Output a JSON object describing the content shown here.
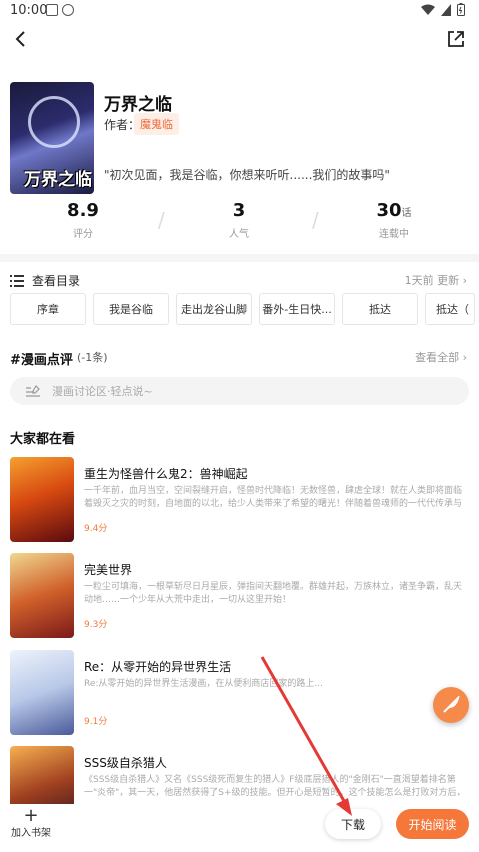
{
  "status": {
    "time": "10:00"
  },
  "book": {
    "title": "万界之临",
    "author_label": "作者：",
    "author": "魔鬼临",
    "cover_text": "万界之临",
    "quote": "\"初次见面，我是谷临，你想来听听......我们的故事吗\""
  },
  "stats": [
    {
      "value": "8.9",
      "unit": "",
      "label": "评分"
    },
    {
      "value": "3",
      "unit": "",
      "label": "人气"
    },
    {
      "value": "30",
      "unit": "话",
      "label": "连载中"
    }
  ],
  "catalog": {
    "title": "查看目录",
    "update": "1天前 更新 ›",
    "chapters": [
      "序章",
      "我是谷临",
      "走出龙谷山脚",
      "番外-生日快...",
      "抵达",
      "抵达（"
    ]
  },
  "comments": {
    "title": "#漫画点评",
    "count": "(-1条)",
    "view_all": "查看全部 ›",
    "placeholder": "漫画讨论区·轻点说~"
  },
  "recommend": {
    "title": "大家都在看",
    "items": [
      {
        "name": "重生为怪兽什么鬼2：兽神崛起",
        "desc": "一千年前，血月当空，空间裂缝开启，怪兽时代降临！无数怪兽，肆虐全球！就在人类即将面临着毁灭之灾的时刻，自地面的以北，给少人类带来了希望的曙光！伴随着兽魂师的一代代传承与发展，人类成功创造出...",
        "score": "9.4分",
        "colors": [
          "#f07a1a",
          "#8a1a0a"
        ]
      },
      {
        "name": "完美世界",
        "desc": "一粒尘可填海，一根草斩尽日月星辰，弹指间天翻地覆。群雄并起，万族林立，诸圣争霸，乱天动地……一个少年从大荒中走出，一切从这里开始！",
        "score": "9.3分",
        "colors": [
          "#e8c070",
          "#a0301a"
        ]
      },
      {
        "name": "Re：从零开始的异世界生活",
        "desc": "Re:从零开始的异世界生活漫画，在从便利商店回家的路上...",
        "score": "9.1分",
        "colors": [
          "#d8e4f4",
          "#7a8ac0"
        ]
      },
      {
        "name": "SSS级自杀猎人",
        "desc": "《SSS级自杀猎人》又名《SSS级死而复生的猎人》F级底层猎人的\"金刚石\"一直渴望着排名第一\"炎帝\"，其一天，他居然获得了S+级的技能。但开心是短暂的，这个技能怎么是打败对方后，能够复制对方的一个技能。到这...",
        "score": "",
        "colors": [
          "#f0a040",
          "#3a1a2a"
        ]
      }
    ]
  },
  "actions": {
    "shelf": "加入书架",
    "download": "下载",
    "read": "开始阅读"
  },
  "accent": "#f6773a"
}
